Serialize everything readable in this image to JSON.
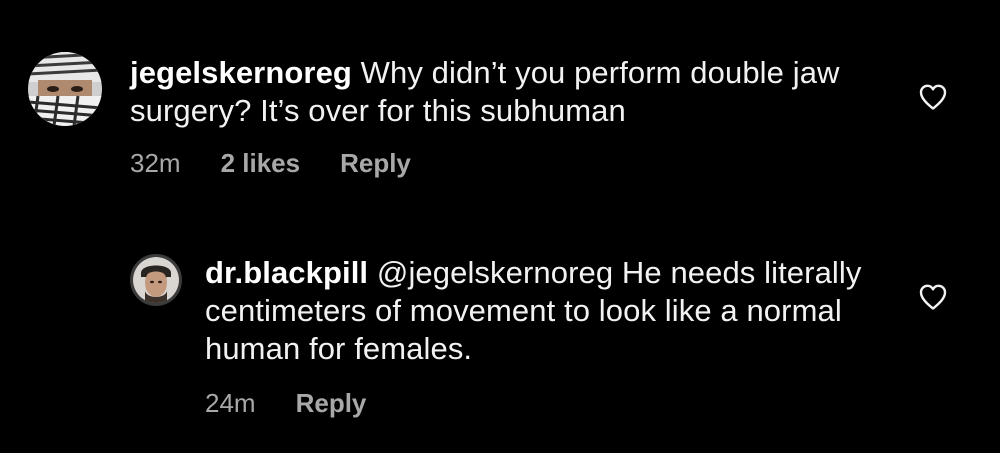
{
  "comments": [
    {
      "username": "jegelskernoreg",
      "text": " Why didn’t you perform double jaw surgery? It’s over for this subhuman",
      "time": "32m",
      "likes": "2 likes",
      "reply_label": "Reply"
    },
    {
      "username": "dr.blackpill",
      "text": " @jegelskernoreg He needs literally centimeters of movement to look like a normal human for females.",
      "time": "24m",
      "reply_label": "Reply"
    }
  ],
  "icons": {
    "like": "heart-outline-icon"
  },
  "colors": {
    "background": "#000000",
    "text": "#f2f2f2",
    "muted": "#a8a8a8"
  }
}
